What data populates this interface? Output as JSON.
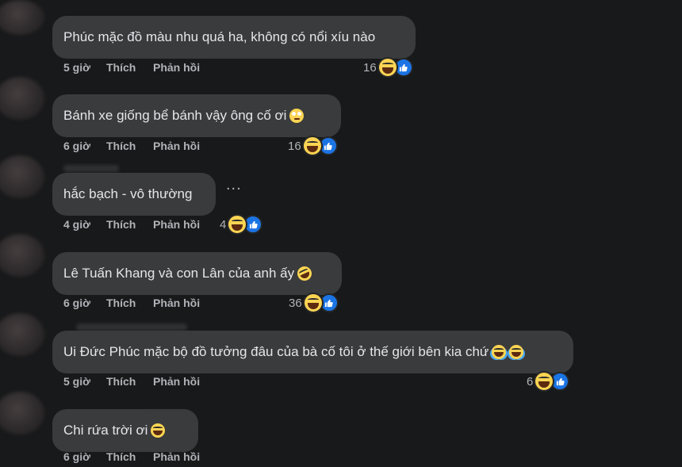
{
  "actions": {
    "like": "Thích",
    "reply": "Phản hồi"
  },
  "comments": [
    {
      "text": "Phúc mặc đồ màu nhu quá ha, không có nổi xíu nào",
      "time": "5 giờ",
      "reactions": "16"
    },
    {
      "text": "Bánh xe giống bể bánh vậy ông cố ơi",
      "time": "6 giờ",
      "reactions": "16",
      "emoji": "face-with-rolling-eyes"
    },
    {
      "text": "hắc bạch - vô thường",
      "time": "4 giờ",
      "reactions": "4",
      "more": "..."
    },
    {
      "text": "Lê Tuấn Khang và con Lân của anh ấy",
      "time": "6 giờ",
      "reactions": "36",
      "emoji": "rolling-on-floor-laughing"
    },
    {
      "text": "Ui Đức Phúc mặc bộ đồ tưởng đâu của bà cố tôi ở thế giới bên kia chứ",
      "time": "5 giờ",
      "reactions": "6",
      "emoji": "face-with-tears-of-joy x2"
    },
    {
      "text": "Chi rứa trời ơi",
      "time": "6 giờ",
      "reactions": "",
      "emoji": "grinning-squinting-face"
    }
  ],
  "colors": {
    "background": "#18191a",
    "bubble": "#3a3b3c",
    "text": "#e4e6eb",
    "secondary": "#b0b3b8",
    "like_blue": "#1b74e4",
    "haha_yellow": "#fbd453"
  }
}
